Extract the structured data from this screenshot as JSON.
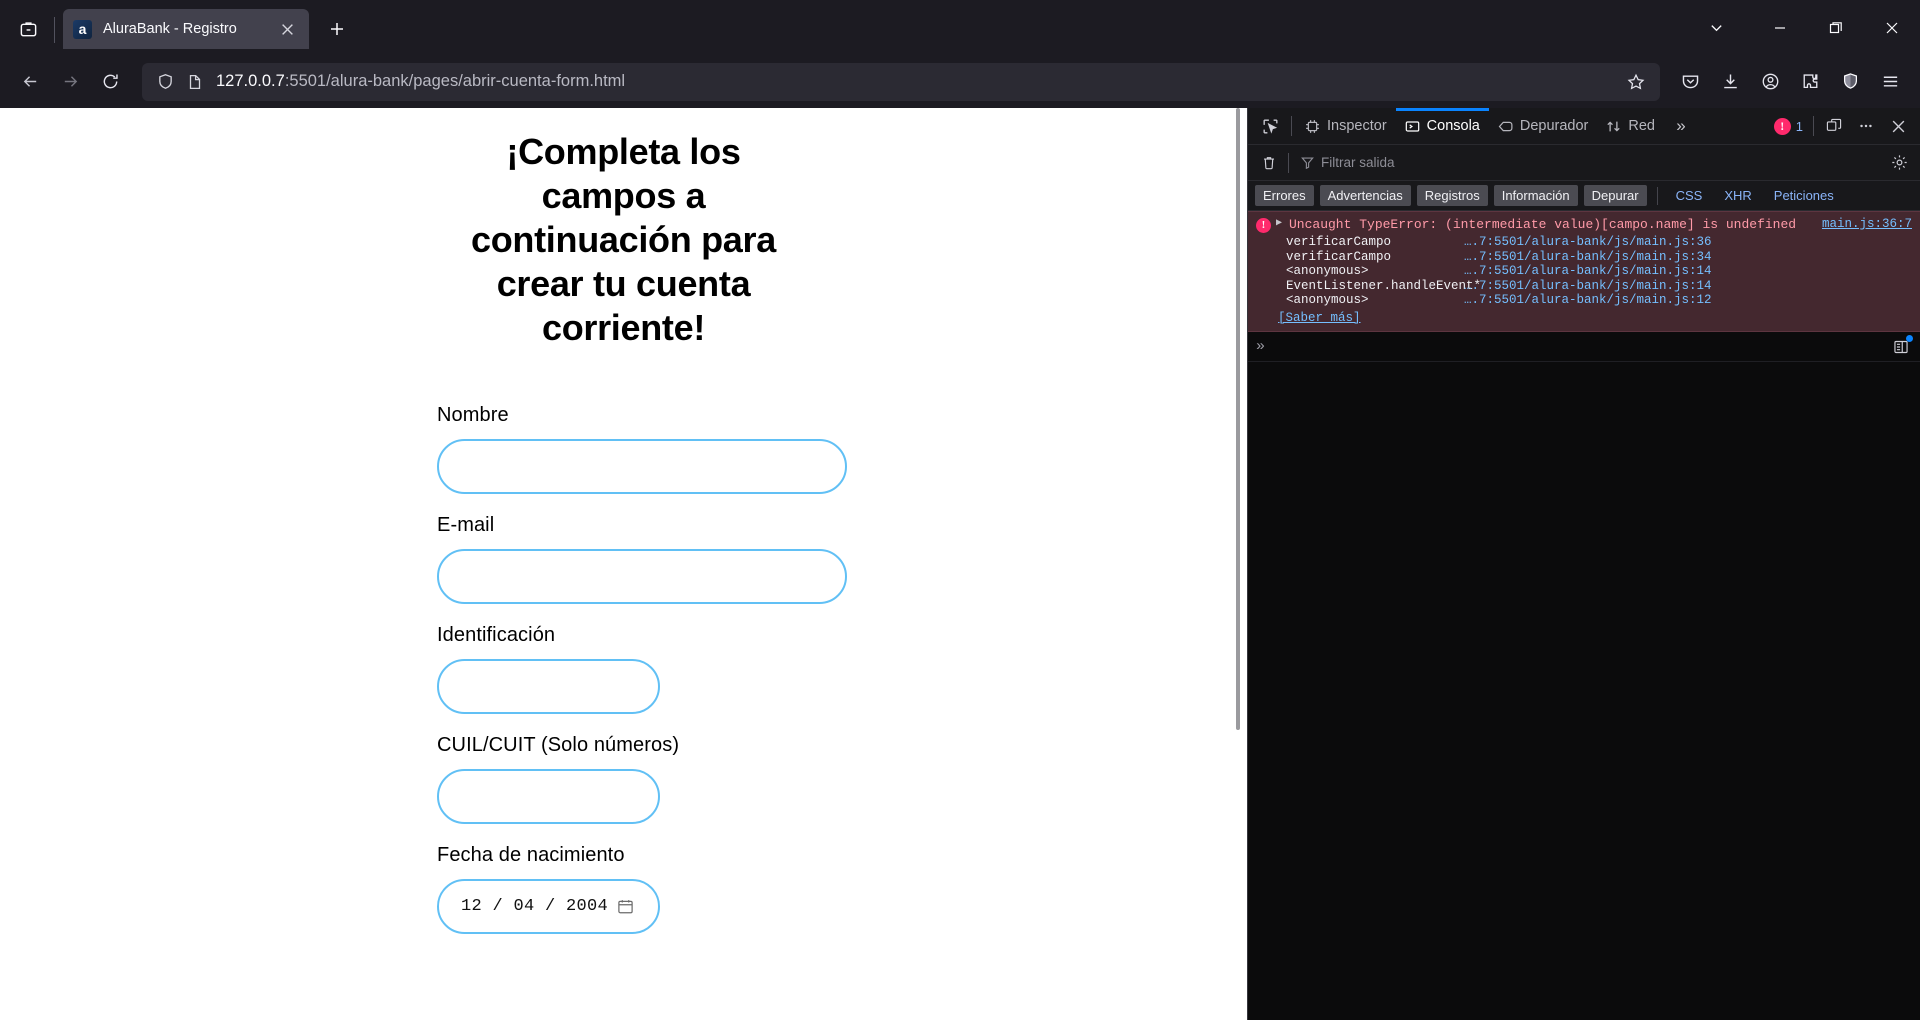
{
  "browser": {
    "tab": {
      "favicon_letter": "a",
      "title": "AluraBank - Registro",
      "close_label": "×"
    },
    "new_tab_label": "+",
    "url": {
      "host": "127.0.0.7",
      "path": ":5501/alura-bank/pages/abrir-cuenta-form.html",
      "full": "127.0.0.7:5501/alura-bank/pages/abrir-cuenta-form.html"
    },
    "window_controls": {
      "list_all_tabs": "chevron-down",
      "minimize": "—",
      "restore": "restore",
      "close": "×"
    },
    "toolbar_icons": [
      "pocket-icon",
      "downloads-icon",
      "account-icon",
      "extensions-icon",
      "shield-icon",
      "app-menu-icon"
    ]
  },
  "page": {
    "heading": "¡Completa los campos a continuación para crear tu cuenta corriente!",
    "fields": [
      {
        "label": "Nombre",
        "value": "",
        "width": "wide",
        "type": "text"
      },
      {
        "label": "E-mail",
        "value": "",
        "width": "wide",
        "type": "email"
      },
      {
        "label": "Identificación",
        "value": "",
        "width": "narrow",
        "type": "text"
      },
      {
        "label": "CUIL/CUIT (Solo números)",
        "value": "",
        "width": "narrow",
        "type": "text"
      },
      {
        "label": "Fecha de nacimiento",
        "value": "12 / 04 / 2004",
        "width": "narrow",
        "type": "date"
      }
    ],
    "input_border_color": "#61c0f5"
  },
  "devtools": {
    "tabs": [
      {
        "label": "Inspector",
        "active": false,
        "icon": "inspector-icon"
      },
      {
        "label": "Consola",
        "active": true,
        "icon": "console-icon"
      },
      {
        "label": "Depurador",
        "active": false,
        "icon": "debugger-icon"
      },
      {
        "label": "Red",
        "active": false,
        "icon": "network-icon"
      }
    ],
    "overflow_label": "»",
    "error_count": "1",
    "filter": {
      "placeholder": "Filtrar salida",
      "value": ""
    },
    "severity_chips": [
      "Errores",
      "Advertencias",
      "Registros",
      "Información",
      "Depurar"
    ],
    "request_chips": [
      "CSS",
      "XHR",
      "Peticiones"
    ],
    "console_messages": [
      {
        "severity": "error",
        "text": "Uncaught TypeError: (intermediate value)[campo.name] is undefined",
        "source": "main.js:36:7",
        "stack": [
          {
            "fn": "verificarCampo",
            "loc": "….7:5501/alura-bank/js/main.js:36"
          },
          {
            "fn": "verificarCampo",
            "loc": "….7:5501/alura-bank/js/main.js:34"
          },
          {
            "fn": "<anonymous>",
            "loc": "….7:5501/alura-bank/js/main.js:14"
          },
          {
            "fn": "EventListener.handleEvent*",
            "loc": "….7:5501/alura-bank/js/main.js:14"
          },
          {
            "fn": "<anonymous>",
            "loc": "….7:5501/alura-bank/js/main.js:12"
          }
        ],
        "learn_more": "[Saber más]"
      }
    ],
    "prompt_chevron": "»",
    "accent_color": "#0a84ff",
    "error_color": "#ff2a6c"
  }
}
